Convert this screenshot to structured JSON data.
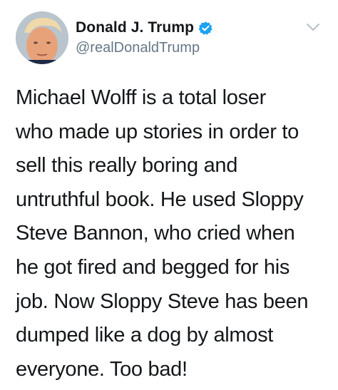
{
  "author": {
    "display_name": "Donald J. Trump",
    "handle": "@realDonaldTrump",
    "verified": true,
    "avatar_icon": "profile-photo"
  },
  "menu_icon": "chevron-down-icon",
  "tweet": {
    "lines": [
      "Michael Wolff is a total loser",
      "who made up stories in order to",
      "sell this really boring and",
      "untruthful book. He used Sloppy",
      "Steve Bannon, who cried when",
      "he got fired and begged for his",
      "job. Now Sloppy Steve has been",
      "dumped like a dog by almost",
      "everyone. Too bad!"
    ]
  },
  "colors": {
    "verified_badge": "#1da1f2",
    "handle_text": "#657786",
    "body_text": "#14171a",
    "chevron": "#aab8c2"
  }
}
